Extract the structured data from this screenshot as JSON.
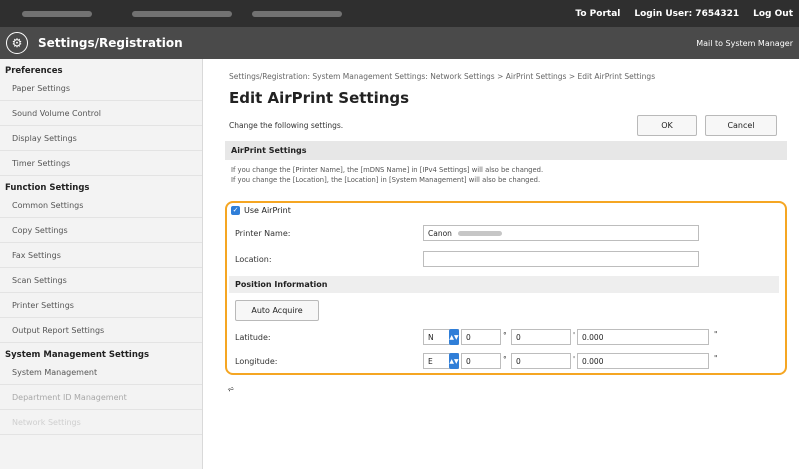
{
  "topbar": {
    "portal_link": "To Portal",
    "login_user": "Login User: 7654321",
    "logout": "Log Out"
  },
  "header": {
    "title": "Settings/Registration",
    "mail_link": "Mail to System Manager",
    "icon": "settings-gear-icon"
  },
  "sidebar": {
    "sections": [
      {
        "heading": "Preferences",
        "items": [
          "Paper Settings",
          "Sound Volume Control",
          "Display Settings",
          "Timer Settings"
        ]
      },
      {
        "heading": "Function Settings",
        "items": [
          "Common Settings",
          "Copy Settings",
          "Fax Settings",
          "Scan Settings",
          "Printer Settings",
          "Output Report Settings"
        ]
      },
      {
        "heading": "System Management Settings",
        "items": [
          "System Management",
          "Department ID Management",
          "Network Settings"
        ]
      }
    ]
  },
  "main": {
    "breadcrumb": "Settings/Registration: System Management Settings: Network Settings > AirPrint Settings > Edit AirPrint Settings",
    "title": "Edit AirPrint Settings",
    "instruction": "Change the following settings.",
    "ok_label": "OK",
    "cancel_label": "Cancel",
    "panel_title": "AirPrint Settings",
    "note1": "If you change the [Printer Name], the [mDNS Name] in [IPv4 Settings] will also be changed.",
    "note2": "If you change the [Location], the [Location] in [System Management] will also be changed.",
    "use_airprint_label": "Use AirPrint",
    "use_airprint_checked": true,
    "printer_name_label": "Printer Name:",
    "printer_name_value": "Canon",
    "location_label": "Location:",
    "location_value": "",
    "position_heading": "Position Information",
    "auto_acquire_label": "Auto Acquire",
    "latitude_label": "Latitude:",
    "latitude_dir": "N",
    "latitude_deg": "0",
    "latitude_min": "0",
    "latitude_sec": "0.000",
    "longitude_label": "Longitude:",
    "longitude_dir": "E",
    "longitude_deg": "0",
    "longitude_min": "0",
    "longitude_sec": "0.000",
    "deg_symbol": "°",
    "min_symbol": "'",
    "sec_symbol": "\"",
    "to_top_symbol": "⩫",
    "highlight_color": "#f5a623",
    "accent_color": "#2f7ed8"
  }
}
